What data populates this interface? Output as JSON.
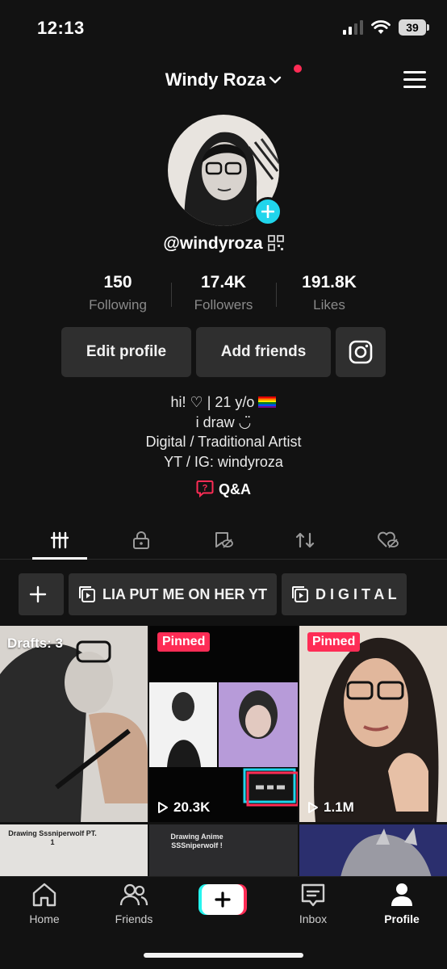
{
  "status_bar": {
    "time": "12:13",
    "battery": "39"
  },
  "header": {
    "username": "Windy Roza"
  },
  "profile": {
    "handle": "@windyroza",
    "stats": [
      {
        "value": "150",
        "label": "Following"
      },
      {
        "value": "17.4K",
        "label": "Followers"
      },
      {
        "value": "191.8K",
        "label": "Likes"
      }
    ],
    "edit_profile": "Edit profile",
    "add_friends": "Add friends",
    "bio": {
      "line1": "hi! ♡ | 21 y/o",
      "line2": "i draw ◡̈",
      "line3": "Digital / Traditional Artist",
      "line4": "YT / IG: windyroza"
    },
    "qa_label": "Q&A"
  },
  "tabs": [
    "videos-grid",
    "private",
    "favorites",
    "reposts",
    "liked"
  ],
  "playlists": [
    "LIA PUT ME ON HER YT",
    "D I G I T A L"
  ],
  "grid": {
    "drafts": "Drafts: 3",
    "pinned_label": "Pinned",
    "views": [
      "20.3K",
      "1.1M"
    ],
    "captions": [
      "Drawing Sssniperwolf PT. 1",
      "Drawing Anime SSSniperwolf !"
    ]
  },
  "bottom_nav": {
    "home": "Home",
    "friends": "Friends",
    "inbox": "Inbox",
    "profile": "Profile"
  },
  "colors": {
    "accent": "#fe2c55",
    "teal": "#20d5ec",
    "background": "#121212",
    "button": "#2f2f2f"
  }
}
